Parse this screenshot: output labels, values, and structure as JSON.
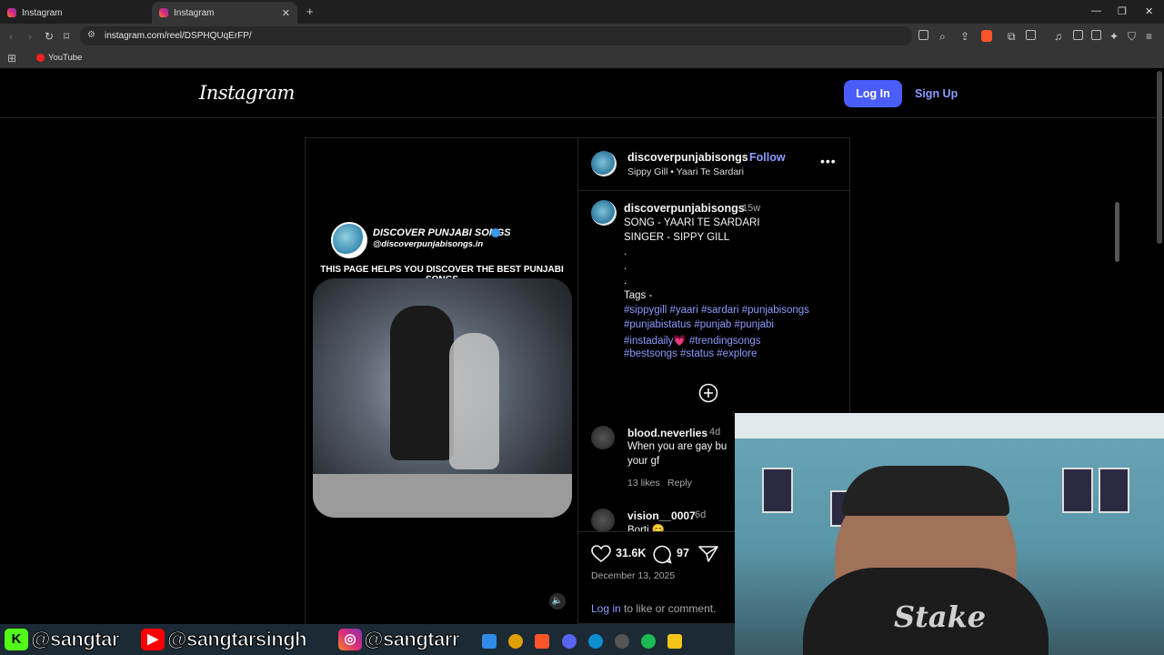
{
  "browser": {
    "tabs": [
      {
        "label": "Instagram"
      },
      {
        "label": "Instagram"
      }
    ],
    "url": "instagram.com/reel/DSPHQUqErFP/",
    "bookmarks": [
      {
        "label": "YouTube"
      }
    ]
  },
  "header": {
    "logo": "Instagram",
    "login_label": "Log In",
    "signup_label": "Sign Up"
  },
  "video": {
    "title": "DISCOVER PUNJABI SONGS",
    "handle": "@discoverpunjabisongs.in",
    "caption": "THIS PAGE HELPS YOU DISCOVER THE BEST PUNJABI SONGS",
    "mute_icon": "speaker-icon"
  },
  "post": {
    "owner": "discoverpunjabisongs",
    "separator": "•",
    "follow_label": "Follow",
    "audio": "Sippy Gill • Yaari Te Sardari",
    "caption": {
      "user": "discoverpunjabisongs",
      "time": "15w",
      "lines": [
        "SONG - YAARI TE SARDARI",
        "SINGER - SIPPY GILL",
        ".",
        ".",
        ".",
        "Tags -"
      ],
      "tag_lines": [
        "#sippygill #yaari #sardari #punjabisongs",
        "#punjabistatus #punjab #punjabi",
        "#instadaily💗 #trendingsongs",
        "#bestsongs #status #explore"
      ]
    },
    "comments": [
      {
        "user": "blood.neverlies",
        "time": "4d",
        "text_1": "When you are gay bu",
        "text_2": "your gf",
        "likes": "13 likes",
        "reply": "Reply"
      },
      {
        "user": "vision__0007",
        "time": "6d",
        "text_1": "Borti 😊"
      }
    ],
    "likes": "31.6K",
    "comments_count": "97",
    "date": "December 13, 2025",
    "login_link": "Log in",
    "login_rest": " to like or comment."
  },
  "overlay": {
    "kick_handle": "@sangtar",
    "youtube_handle": "@sangtarsingh",
    "instagram_handle": "@sangtarr",
    "kick_letter": "K",
    "shirt_text": "Stake"
  }
}
